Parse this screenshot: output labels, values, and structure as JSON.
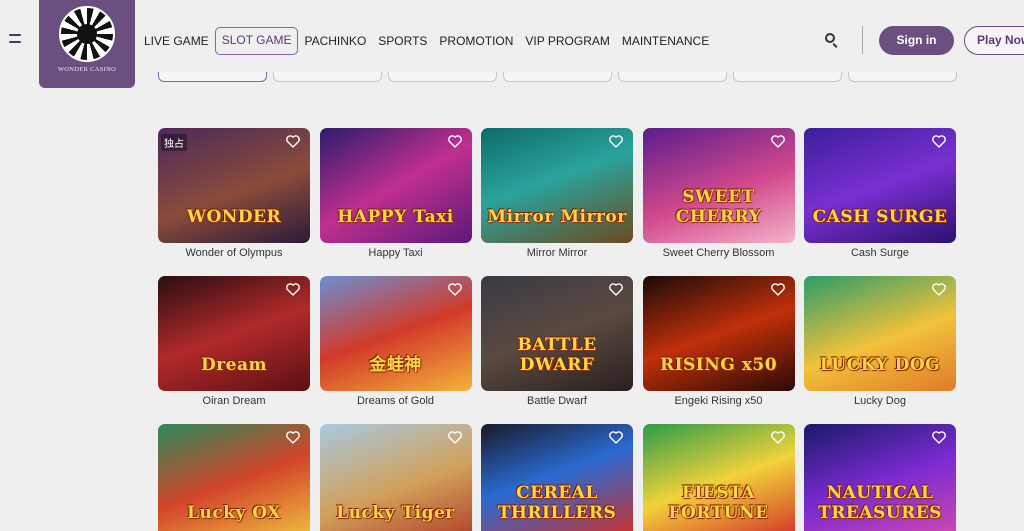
{
  "header": {
    "logo_text": "WONDER CASINO",
    "nav": [
      {
        "label": "LIVE GAME",
        "active": false
      },
      {
        "label": "SLOT GAME",
        "active": true
      },
      {
        "label": "PACHINKO",
        "active": false
      },
      {
        "label": "SPORTS",
        "active": false
      },
      {
        "label": "PROMOTION",
        "active": false
      },
      {
        "label": "VIP PROGRAM",
        "active": false
      },
      {
        "label": "MAINTENANCE",
        "active": false
      }
    ],
    "signin_label": "Sign in",
    "play_label": "Play Now"
  },
  "colors": {
    "brand": "#6b4f80",
    "accent_border": "#8a63a8",
    "background": "#f0eff0"
  },
  "icons": {
    "menu": "hamburger-icon",
    "search": "search-icon",
    "favorite": "heart-icon"
  },
  "games": [
    {
      "name": "Wonder of Olympus",
      "art_title": "WONDER",
      "badge": "独占",
      "bg": "linear-gradient(160deg,#4b2a5a,#8a4b3a 55%,#2a1b3a)"
    },
    {
      "name": "Happy Taxi",
      "art_title": "HAPPY Taxi",
      "badge": "",
      "bg": "linear-gradient(150deg,#2b1d6b,#c02f8f 50%,#5a1a7a)"
    },
    {
      "name": "Mirror Mirror",
      "art_title": "Mirror Mirror",
      "badge": "",
      "bg": "linear-gradient(160deg,#0e6b6a,#2aa39c 45%,#6b4a20)"
    },
    {
      "name": "Sweet Cherry Blossom",
      "art_title": "SWEET CHERRY",
      "badge": "",
      "bg": "linear-gradient(160deg,#5a1d8c,#d2488d 55%,#f4b3c9)"
    },
    {
      "name": "Cash Surge",
      "art_title": "CASH SURGE",
      "badge": "",
      "bg": "linear-gradient(160deg,#3b1f9c,#7a2fd1 50%,#2a1270)"
    },
    {
      "name": "Oiran Dream",
      "art_title": "Dream",
      "badge": "",
      "bg": "linear-gradient(160deg,#2a0d12,#b22a2a 50%,#5a1014)"
    },
    {
      "name": "Dreams of Gold",
      "art_title": "金蛙神",
      "badge": "",
      "bg": "linear-gradient(160deg,#6b8fd1,#d23a2a 50%,#f4b33a)"
    },
    {
      "name": "Battle Dwarf",
      "art_title": "BATTLE DWARF",
      "badge": "",
      "bg": "linear-gradient(160deg,#3a3a45,#5a4a40 50%,#2a2020)"
    },
    {
      "name": "Engeki Rising x50",
      "art_title": "RISING x50",
      "badge": "",
      "bg": "linear-gradient(160deg,#1a0a0a,#c0300a 50%,#2a0a05)"
    },
    {
      "name": "Lucky Dog",
      "art_title": "LUCKY DOG",
      "badge": "",
      "bg": "linear-gradient(160deg,#2a9c6a,#f2c23a 55%,#e07a2a)"
    },
    {
      "name": "Lucky Ox",
      "art_title": "Lucky OX",
      "badge": "",
      "bg": "linear-gradient(160deg,#2a8a5a,#d2442a 50%,#f0c040)"
    },
    {
      "name": "Lucky Tiger",
      "art_title": "Lucky Tiger",
      "badge": "",
      "bg": "linear-gradient(160deg,#a8c8e0,#d2a05a 55%,#b0402a)"
    },
    {
      "name": "Cereal Thrillers",
      "art_title": "CEREAL THRILLERS",
      "badge": "",
      "bg": "linear-gradient(160deg,#1a1a2a,#2a6ad1 45%,#d2302a)"
    },
    {
      "name": "Fiesta Fortune",
      "art_title": "FIESTA FORTUNE",
      "badge": "",
      "bg": "linear-gradient(160deg,#2a9c4a,#f2d23a 50%,#d2302a)"
    },
    {
      "name": "Nautical Treasures",
      "art_title": "NAUTICAL TREASURES",
      "badge": "",
      "bg": "linear-gradient(160deg,#1a1a6a,#7a2ad1 50%,#d24ab0)"
    }
  ]
}
